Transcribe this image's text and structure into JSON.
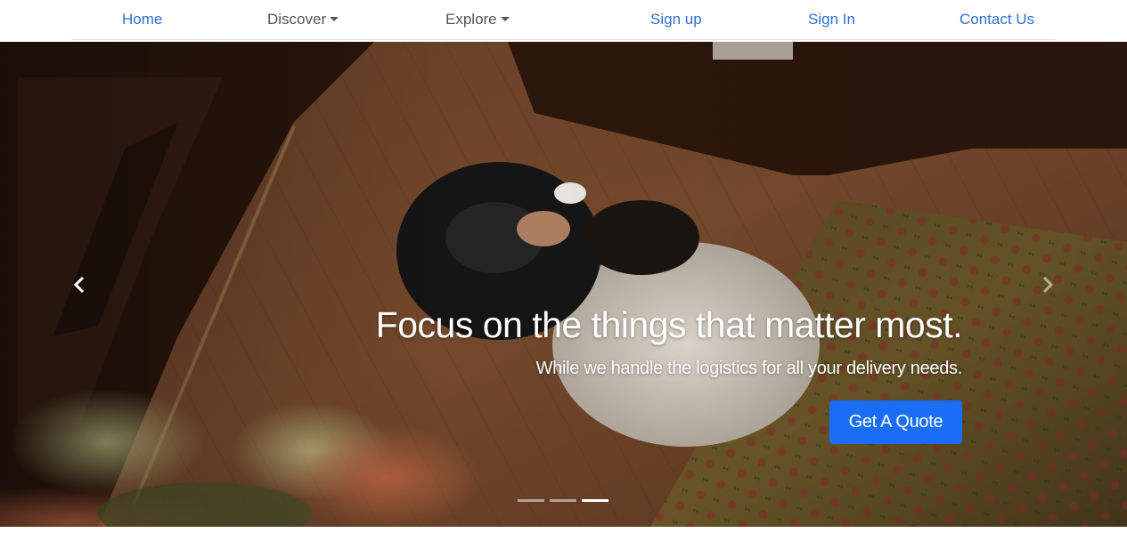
{
  "nav": {
    "home": "Home",
    "discover": "Discover",
    "explore": "Explore",
    "signup": "Sign up",
    "signin": "Sign In",
    "contact": "Contact Us"
  },
  "hero": {
    "title": "Focus on the things that matter most.",
    "subtitle": "While we handle the logistics for all your delivery needs.",
    "cta": "Get A Quote",
    "prev_icon": "chevron-left-icon",
    "next_icon": "chevron-right-icon",
    "slide_count": 3,
    "active_slide": 3
  },
  "colors": {
    "link": "#2f6fd6",
    "dropdown_text": "#555555",
    "button": "#1a6ef5"
  }
}
